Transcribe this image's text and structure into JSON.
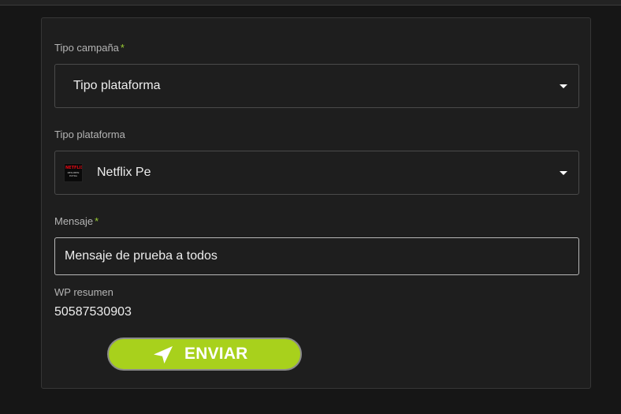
{
  "form": {
    "campaign_type": {
      "label": "Tipo campaña",
      "required_mark": "*",
      "selected": "Tipo plataforma"
    },
    "platform_type": {
      "label": "Tipo plataforma",
      "selected": "Netflix Pe",
      "logo": {
        "icon": "netflix-logo-icon",
        "line1": "NETFLIX",
        "line2": "RESUMEN",
        "line3": "EXTRA"
      }
    },
    "message": {
      "label": "Mensaje",
      "required_mark": "*",
      "value": "Mensaje de prueba a todos"
    },
    "summary": {
      "label": "WP resumen",
      "value": "50587530903"
    },
    "send_button": {
      "label": "ENVIAR",
      "icon": "send-icon"
    }
  },
  "colors": {
    "accent": "#a8d11c",
    "required": "#9acd32",
    "background": "#161616",
    "panel": "#1e1e1e"
  }
}
